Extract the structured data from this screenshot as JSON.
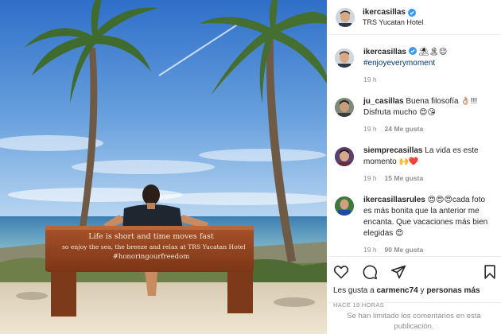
{
  "post": {
    "author": "ikercasillas",
    "location": "TRS Yucatan Hotel",
    "bench_text": [
      "Life is short and time moves fast",
      "so enjoy the sea, the breeze and relax at TRS Yucatan Hotel",
      "#honoringourfreedom"
    ]
  },
  "comments": [
    {
      "user": "ikercasillas",
      "text": "⛱🏝😉",
      "hashtag": "#enjoyeverymoment",
      "time": "19 h",
      "likes": ""
    },
    {
      "user": "ju_casillas",
      "text": "Buena filosofía 👌🏼!!! Disfruta mucho 😍😘",
      "hashtag": "",
      "time": "19 h",
      "likes": "24 Me gusta"
    },
    {
      "user": "siemprecasillas",
      "text": "La vida es este momento 🙌❤️",
      "hashtag": "",
      "time": "19 h",
      "likes": "15 Me gusta"
    },
    {
      "user": "ikercasillasrules",
      "text": "😍😍😍cada foto es más bonita que la anterior me encanta. Que vacaciones más bien elegidas 😍",
      "hashtag": "",
      "time": "19 h",
      "likes": "90 Me gusta"
    }
  ],
  "likes_line": {
    "prefix": "Les gusta a ",
    "user": "carmenc74",
    "middle": " y ",
    "rest": "personas más"
  },
  "time_ago": "HACE 19 HORAS",
  "comments_limited": "Se han limitado los comentarios en esta publicación.",
  "icons": [
    "heart-icon",
    "comment-icon",
    "share-icon",
    "save-icon",
    "verified-icon"
  ],
  "colors": {
    "verified": "#3897f0",
    "hashtag": "#00376b",
    "muted": "#8e8e8e"
  }
}
